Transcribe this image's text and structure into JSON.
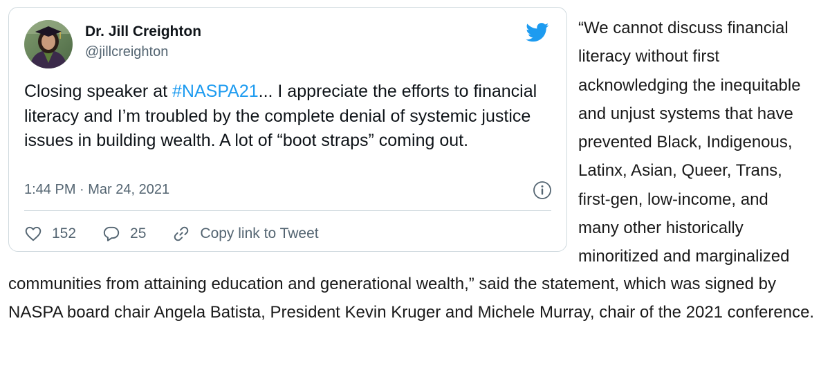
{
  "tweet": {
    "author_name": "Dr. Jill Creighton",
    "author_handle": "@jillcreighton",
    "text_before_hashtag": "Closing speaker at ",
    "hashtag": "#NASPA21",
    "text_after_hashtag": "... I appreciate the efforts to financial literacy and I’m troubled by the complete denial of systemic justice issues in building wealth. A lot of “boot straps” coming out.",
    "timestamp": "1:44 PM · Mar 24, 2021",
    "likes_count": "152",
    "replies_count": "25",
    "copy_link_label": "Copy link to Tweet",
    "icons": {
      "brand": "twitter-bird-icon",
      "info": "info-icon",
      "like": "heart-icon",
      "reply": "speech-bubble-icon",
      "copy": "link-icon"
    }
  },
  "article": {
    "quote_lines": [
      "“We cannot discuss financial",
      "literacy without first",
      "acknowledging the inequitable",
      "and unjust systems that have",
      "prevented Black, Indigenous,",
      "Latinx, Asian, Queer, Trans,",
      "first-gen, low-income, and",
      "many other historically",
      "minoritized and marginalized"
    ],
    "continuation": "communities from attaining education and generational wealth,” said the statement, which was signed by NASPA board chair Angela Batista, President Kevin Kruger and Michele Murray, chair of the 2021 conference."
  },
  "colors": {
    "twitter_blue": "#1d9bf0",
    "secondary_text": "#536471",
    "card_border": "#cfd9de"
  }
}
